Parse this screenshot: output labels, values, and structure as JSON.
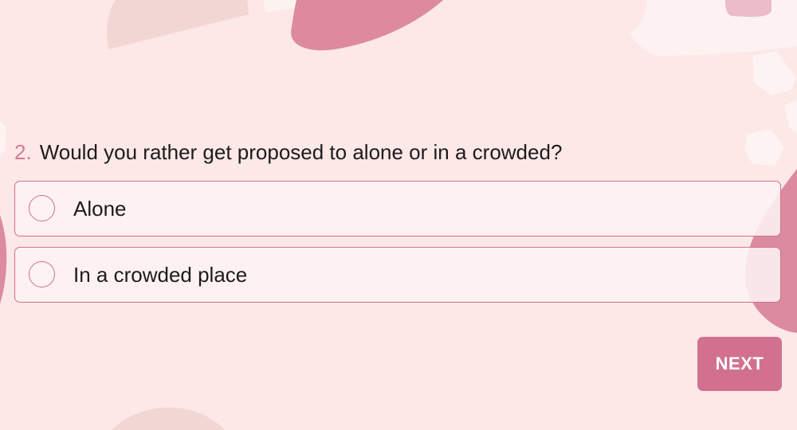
{
  "question": {
    "number": "2.",
    "text": "Would you rather get proposed to alone or in a crowded?"
  },
  "options": [
    {
      "label": "Alone",
      "selected": false
    },
    {
      "label": "In a crowded place",
      "selected": false
    }
  ],
  "next_button": {
    "label": "NEXT"
  },
  "colors": {
    "background": "#fbe8e7",
    "accent": "#d2718f",
    "option_border": "#cf6f8d",
    "option_fill": "#fdf3f2",
    "question_number": "#d27a93"
  }
}
